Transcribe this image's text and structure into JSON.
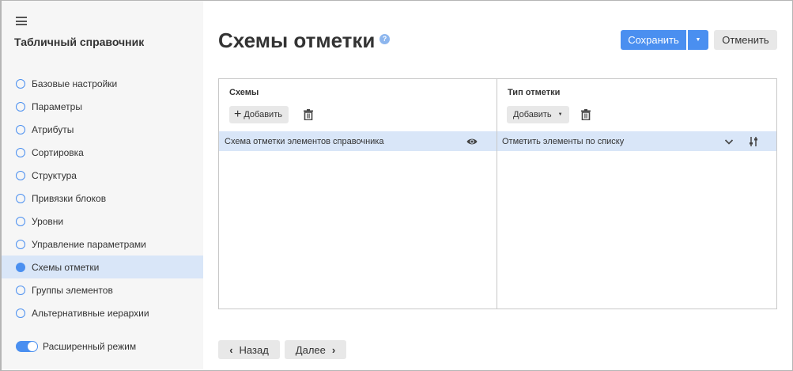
{
  "sidebar": {
    "title": "Табличный справочник",
    "items": [
      {
        "label": "Базовые настройки",
        "active": false
      },
      {
        "label": "Параметры",
        "active": false
      },
      {
        "label": "Атрибуты",
        "active": false
      },
      {
        "label": "Сортировка",
        "active": false
      },
      {
        "label": "Структура",
        "active": false
      },
      {
        "label": "Привязки блоков",
        "active": false
      },
      {
        "label": "Уровни",
        "active": false
      },
      {
        "label": "Управление параметрами",
        "active": false
      },
      {
        "label": "Схемы отметки",
        "active": true
      },
      {
        "label": "Группы элементов",
        "active": false
      },
      {
        "label": "Альтернативные иерархии",
        "active": false
      }
    ],
    "advanced_mode": {
      "label": "Расширенный режим",
      "on": true
    }
  },
  "header": {
    "title": "Схемы отметки",
    "help": "?",
    "save_label": "Сохранить",
    "cancel_label": "Отменить"
  },
  "schemes": {
    "title": "Схемы",
    "add_label": "Добавить",
    "rows": [
      "Схема отметки элементов справочника"
    ]
  },
  "mark_type": {
    "title": "Тип отметки",
    "add_label": "Добавить",
    "rows": [
      "Отметить элементы по списку"
    ]
  },
  "footer": {
    "back_label": "Назад",
    "next_label": "Далее"
  },
  "colors": {
    "accent": "#4a8ff0",
    "selected": "#d9e6f8"
  }
}
